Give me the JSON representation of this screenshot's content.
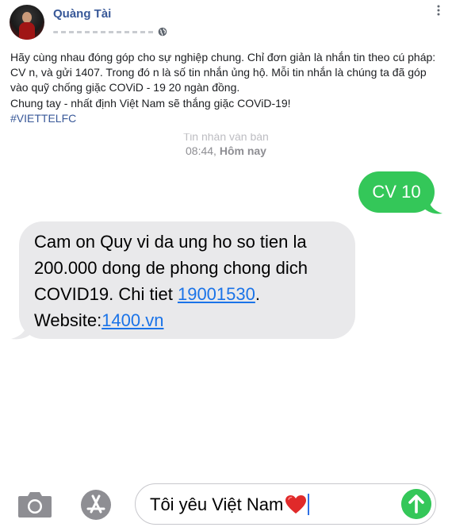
{
  "post": {
    "author_name": "Quàng Tài",
    "body_lines": [
      "Hãy cùng nhau đóng góp cho sự nghiệp chung. Chỉ đơn giản là nhắn tin theo cú pháp: CV n, và gửi 1407. Trong đó n là số tin nhắn ủng hộ. Mỗi tin nhắn là chúng ta đã góp vào quỹ chống giặc COViD - 19 20 ngàn đồng.",
      "Chung tay - nhất định Việt Nam sẽ thắng giặc COViD-19!"
    ],
    "hashtag": "#VIETTELFC",
    "icons": {
      "privacy": "globe-icon",
      "menu": "more-icon"
    }
  },
  "sms": {
    "faded_header": "Tin nhắn văn bản",
    "time": "08:44,",
    "day": "Hôm nay",
    "sent_message": "CV 10",
    "received": {
      "line1": "Cam on Quy vi da ung ho so tien la",
      "line2": "200.000 dong de phong chong dich",
      "line3_prefix": "COVID19. Chi tiet",
      "phone_link": "19001530",
      "line3_suffix": ".",
      "website_label": "Website:",
      "website_link": "1400.vn"
    },
    "compose_text": "Tôi yêu Việt Nam",
    "colors": {
      "sent_bubble": "#34c759",
      "received_bubble": "#e9e9eb",
      "link": "#1a73e8"
    }
  }
}
